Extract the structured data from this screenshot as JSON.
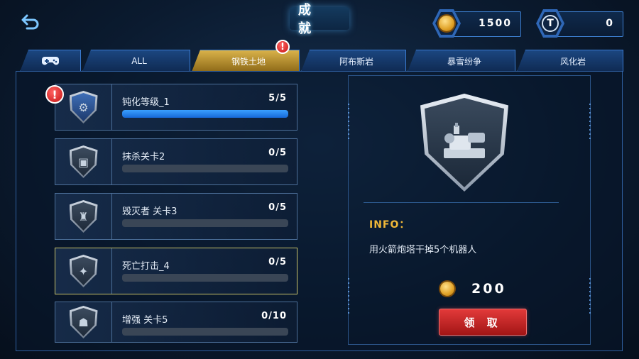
{
  "header": {
    "title": "成 就",
    "back_icon": "back-arrow-icon",
    "coins": {
      "icon": "coin-icon",
      "value": "1500"
    },
    "tokens": {
      "icon": "t-token-icon",
      "letter": "T",
      "value": "0"
    }
  },
  "tabs": [
    {
      "label": "",
      "icon": "gamepad-icon"
    },
    {
      "label": "ALL"
    },
    {
      "label": "钢铁土地",
      "active": true,
      "alert": "!"
    },
    {
      "label": "阿布斯岩"
    },
    {
      "label": "暴雪纷争"
    },
    {
      "label": "风化岩"
    }
  ],
  "achievements": [
    {
      "name": "钝化等级_1",
      "progress": "5/5",
      "fraction": 1.0,
      "alert": "!",
      "icon": "turret-icon"
    },
    {
      "name": "抹杀关卡2",
      "progress": "0/5",
      "fraction": 0,
      "icon": "tank-icon"
    },
    {
      "name": "毁灭者 关卡3",
      "progress": "0/5",
      "fraction": 0,
      "icon": "tower-icon"
    },
    {
      "name": "死亡打击_4",
      "progress": "0/5",
      "fraction": 0,
      "selected": true,
      "icon": "cannon-icon"
    },
    {
      "name": "增强 关卡5",
      "progress": "0/10",
      "fraction": 0,
      "icon": "robot-icon"
    }
  ],
  "detail": {
    "icon": "rocket-turret-icon",
    "info_label": "INFO：",
    "description": "用火箭炮塔干掉5个机器人",
    "reward": "200",
    "claim_label": "领 取"
  },
  "colors": {
    "accent_blue": "#1e7bff",
    "active_tab": "#c99a2e",
    "claim_red": "#c82525",
    "info_gold": "#f0b838"
  }
}
